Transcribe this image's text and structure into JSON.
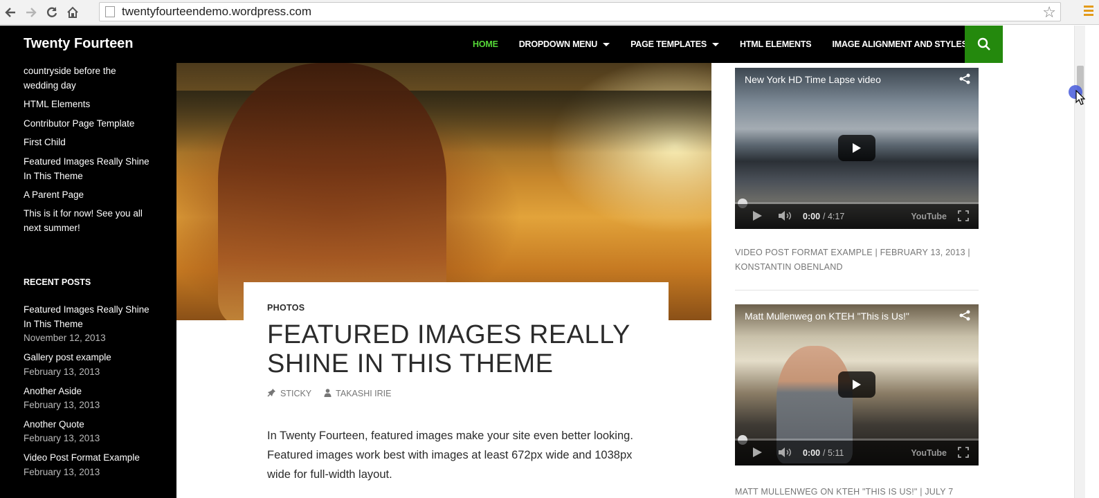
{
  "browser": {
    "url": "twentyfourteendemo.wordpress.com"
  },
  "site": {
    "title": "Twenty Fourteen"
  },
  "nav": {
    "items": [
      {
        "label": "HOME",
        "active": true,
        "has_dropdown": false
      },
      {
        "label": "DROPDOWN MENU",
        "active": false,
        "has_dropdown": true
      },
      {
        "label": "PAGE TEMPLATES",
        "active": false,
        "has_dropdown": true
      },
      {
        "label": "HTML ELEMENTS",
        "active": false,
        "has_dropdown": false
      },
      {
        "label": "IMAGE ALIGNMENT AND STYLES",
        "active": false,
        "has_dropdown": false
      }
    ],
    "search_icon": "search-icon",
    "accent_color": "#24890d",
    "active_color": "#55d737"
  },
  "left_sidebar": {
    "pages": [
      "countryside before the wedding day",
      "HTML Elements",
      "Contributor Page Template",
      "First Child",
      "Featured Images Really Shine In This Theme",
      "A Parent Page",
      "This is it for now! See you all next summer!"
    ],
    "recent_posts_heading": "RECENT POSTS",
    "recent_posts": [
      {
        "title": "Featured Images Really Shine In This Theme",
        "date": "November 12, 2013"
      },
      {
        "title": "Gallery post example",
        "date": "February 13, 2013"
      },
      {
        "title": "Another Aside",
        "date": "February 13, 2013"
      },
      {
        "title": "Another Quote",
        "date": "February 13, 2013"
      },
      {
        "title": "Video Post Format Example",
        "date": "February 13, 2013"
      }
    ]
  },
  "post": {
    "category": "PHOTOS",
    "title": "FEATURED IMAGES REALLY SHINE IN THIS THEME",
    "sticky_label": "STICKY",
    "author": "TAKASHI IRIE",
    "content": "In Twenty Fourteen, featured images make your site even better looking. Featured images work best with images at least 672px wide and 1038px wide for full-width layout."
  },
  "right_column": {
    "videos": [
      {
        "title": "New York HD Time Lapse video",
        "time": "0:00",
        "duration": "/ 4:17",
        "meta": "VIDEO POST FORMAT EXAMPLE | FEBRUARY 13, 2013 | KONSTANTIN OBENLAND"
      },
      {
        "title": "Matt Mullenweg on KTEH \"This is Us!\"",
        "time": "0:00",
        "duration": "/ 5:11",
        "meta": "MATT MULLENWEG ON KTEH \"THIS IS US!\" | JULY 7"
      }
    ],
    "youtube_label": "YouTube"
  }
}
